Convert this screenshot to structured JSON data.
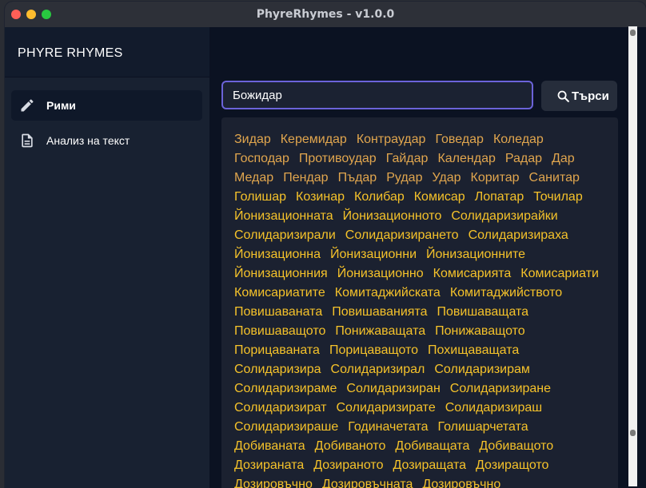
{
  "window": {
    "title": "PhyreRhymes - v1.0.0"
  },
  "sidebar": {
    "brand": "PHYRE RHYMES",
    "items": [
      {
        "label": "Рими",
        "icon": "pencil-icon",
        "active": true
      },
      {
        "label": "Анализ на текст",
        "icon": "document-icon",
        "active": false
      }
    ]
  },
  "search": {
    "value": "Божидар",
    "button_label": "Търси"
  },
  "results": {
    "close_rhymes": [
      "Зидар",
      "Керемидар",
      "Контраудар",
      "Говедар",
      "Коледар",
      "Господар",
      "Противоудар",
      "Гайдар",
      "Календар",
      "Радар",
      "Дар",
      "Медар",
      "Пендар",
      "Пъдар",
      "Рудар",
      "Удар",
      "Коритар",
      "Санитар"
    ],
    "far_rhymes": [
      "Голишар",
      "Козинар",
      "Колибар",
      "Комисар",
      "Лопатар",
      "Точилар",
      "Йонизационната",
      "Йонизационното",
      "Солидаризирайки",
      "Солидаризирали",
      "Солидаризирането",
      "Солидаризираха",
      "Йонизационна",
      "Йонизационни",
      "Йонизационните",
      "Йонизационния",
      "Йонизационно",
      "Комисарията",
      "Комисариати",
      "Комисариатите",
      "Комитаджийската",
      "Комитаджийството",
      "Повишаваната",
      "Повишаванията",
      "Повишаващата",
      "Повишаващото",
      "Понижаващата",
      "Понижаващото",
      "Порицаваната",
      "Порицаващото",
      "Похищаващата",
      "Солидаризира",
      "Солидаризирал",
      "Солидаризирам",
      "Солидаризираме",
      "Солидаризиран",
      "Солидаризиране",
      "Солидаризират",
      "Солидаризирате",
      "Солидаризираш",
      "Солидаризираше",
      "Годиначетата",
      "Голишарчетата",
      "Добиваната",
      "Добиваното",
      "Добиващата",
      "Добиващото",
      "Дозираната",
      "Дозираното",
      "Дозиращата",
      "Дозиращото",
      "Дозировъчно",
      "Дозировъчната",
      "Дозировъчно"
    ]
  },
  "colors": {
    "close": "#e1a64e",
    "far": "#f5c22a",
    "accent": "#6b63d9"
  }
}
